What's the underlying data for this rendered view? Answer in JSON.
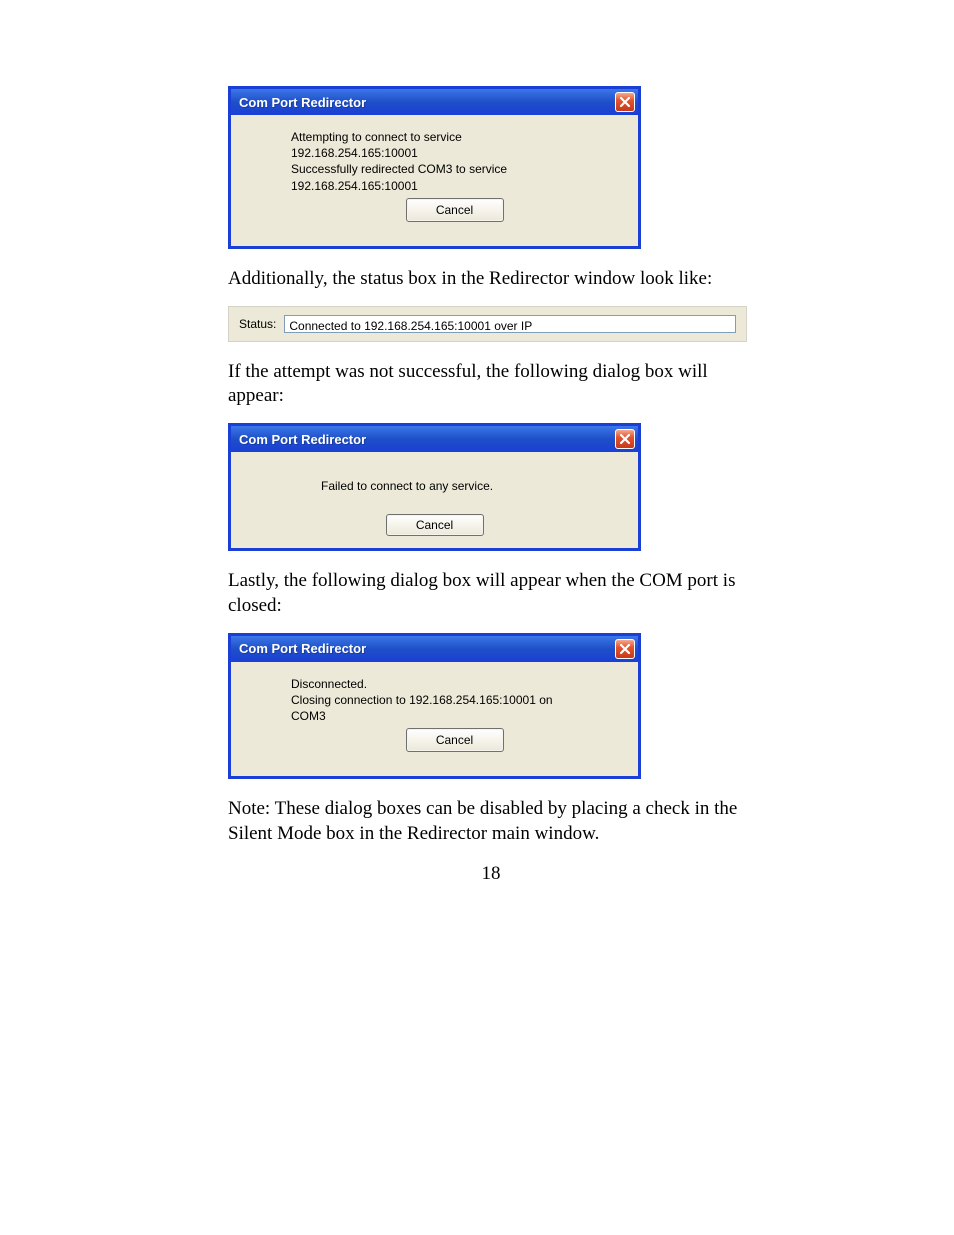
{
  "dialog1": {
    "title": "Com Port Redirector",
    "line1": "Attempting to connect to service",
    "line2": "192.168.254.165:10001",
    "line3": "Successfully redirected COM3 to service",
    "line4": "192.168.254.165:10001",
    "cancel": "Cancel"
  },
  "para1": "Additionally, the status box in the Redirector window look like:",
  "status": {
    "label": "Status:",
    "value": "Connected to 192.168.254.165:10001 over IP"
  },
  "para2": "If the attempt was not successful, the following dialog box will appear:",
  "dialog2": {
    "title": "Com Port Redirector",
    "message": "Failed to connect to any service.",
    "cancel": "Cancel"
  },
  "para3": "Lastly, the following dialog box will appear when the COM port is closed:",
  "dialog3": {
    "title": "Com Port Redirector",
    "line1": "Disconnected.",
    "line2": "Closing connection to 192.168.254.165:10001 on",
    "line3": "COM3",
    "cancel": "Cancel"
  },
  "para4": "Note: These dialog boxes can be disabled by placing a check in the Silent Mode box in the Redirector main window.",
  "page_number": "18"
}
